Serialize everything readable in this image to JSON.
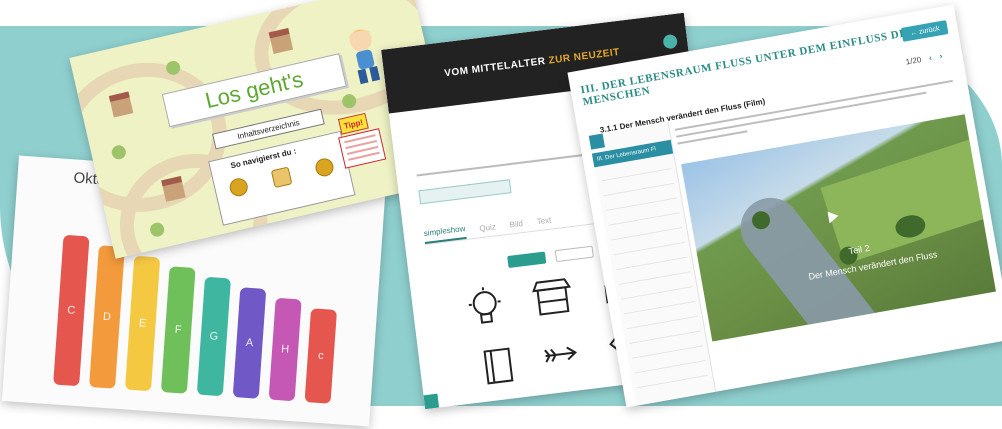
{
  "octave": {
    "title": "Oktav",
    "bars": [
      {
        "note": "C",
        "color": "#e5564f"
      },
      {
        "note": "D",
        "color": "#f29a3c"
      },
      {
        "note": "E",
        "color": "#f5c842"
      },
      {
        "note": "F",
        "color": "#6fc05b"
      },
      {
        "note": "G",
        "color": "#3fb7a0"
      },
      {
        "note": "A",
        "color": "#7058c7"
      },
      {
        "note": "H",
        "color": "#c558b5"
      },
      {
        "note": "c",
        "color": "#e5564f"
      }
    ]
  },
  "losgehts": {
    "title": "Los geht's",
    "toc_label": "Inhaltsverzeichnis",
    "nav_title": "So navigierst du :",
    "tipp_label": "Tipp!"
  },
  "mittelalter": {
    "title_main": "VOM MITTELALTER",
    "title_accent": "ZUR NEUZEIT",
    "tabs": [
      "simpleshow",
      "Quiz",
      "Bild",
      "Text"
    ]
  },
  "fluss": {
    "header": "III. DER LEBENSRAUM FLUSS UNTER DEM EINFLUSS DES MENSCHEN",
    "back_label": "← zurück",
    "pager": "1/20",
    "lesson_title": "3.1.1 Der Mensch verändert den Fluss (Film)",
    "active_nav": "III. Der Lebensraum Fl",
    "video_part": "Teil 2",
    "video_caption": "Der Mensch verändert den Fluss"
  },
  "colors": {
    "teal_background": "#8fd0cf",
    "accent_teal": "#2a8b86",
    "accent_orange": "#e4a82e"
  }
}
